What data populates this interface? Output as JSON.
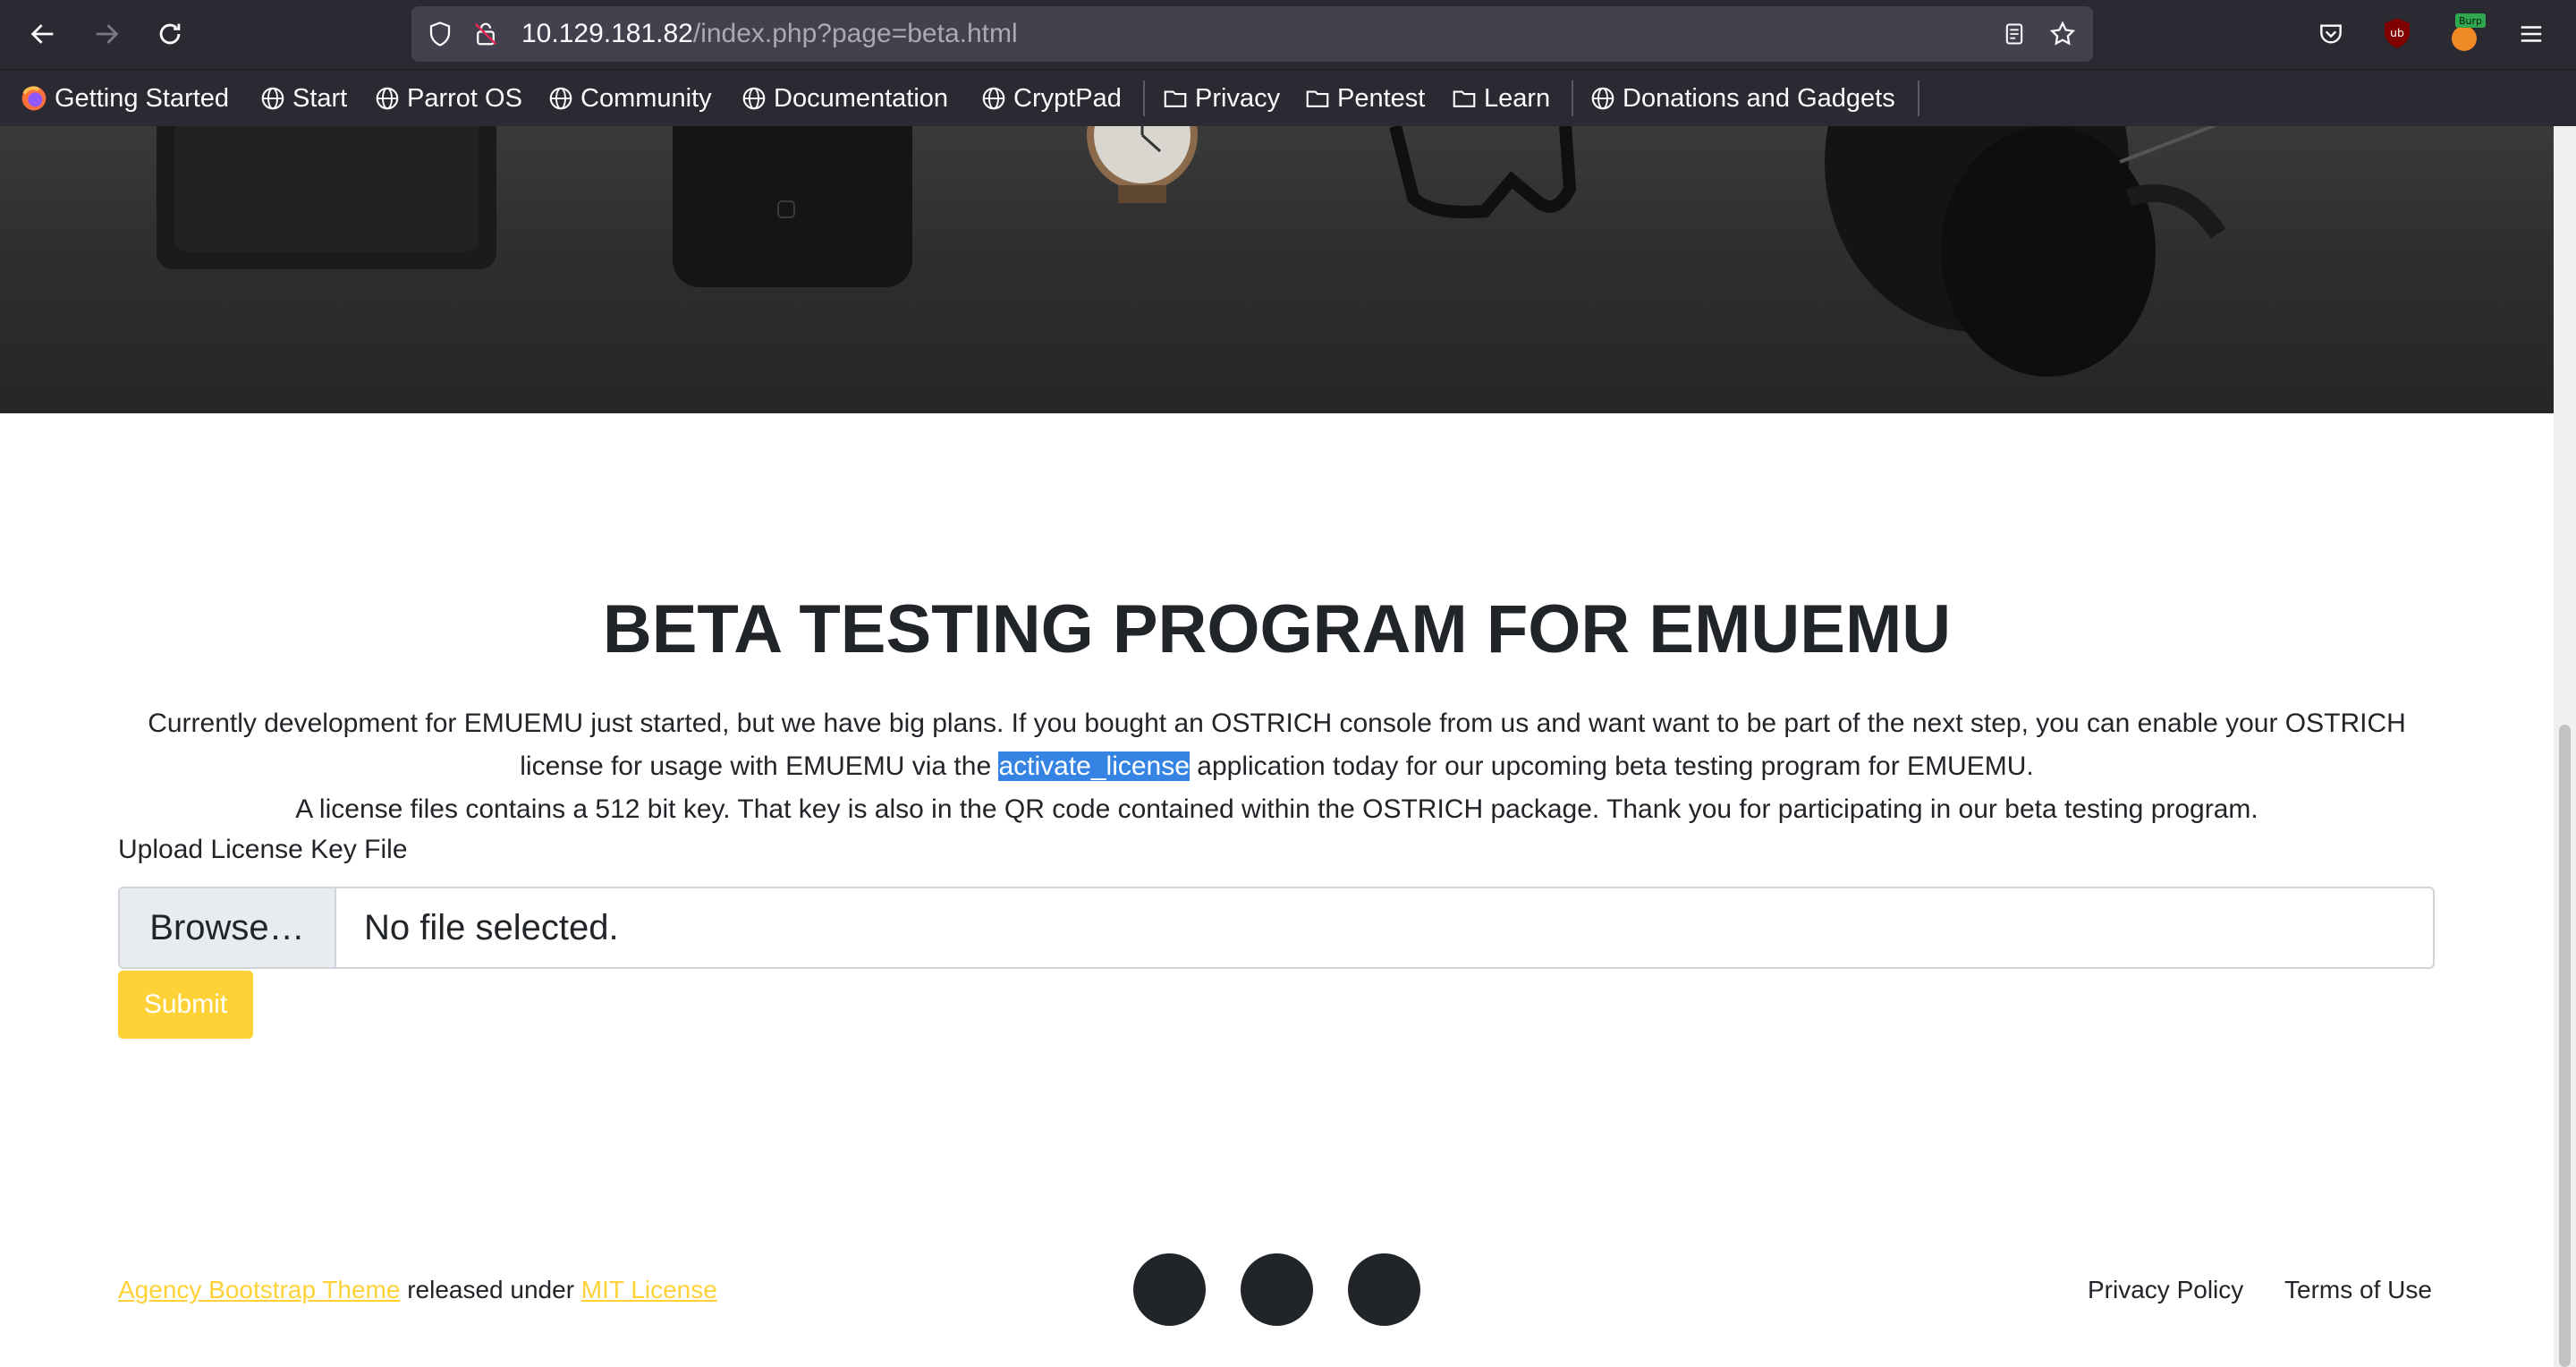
{
  "browser": {
    "url_host": "10.129.181.82",
    "url_path": "/index.php?page=beta.html",
    "burp_badge": "Burp",
    "ublock_badge": "ub"
  },
  "bookmarks": [
    {
      "label": "Getting Started",
      "icon": "firefox-icon"
    },
    {
      "label": "Start",
      "icon": "globe-icon"
    },
    {
      "label": "Parrot OS",
      "icon": "globe-icon"
    },
    {
      "label": "Community",
      "icon": "globe-icon"
    },
    {
      "label": "Documentation",
      "icon": "globe-icon"
    },
    {
      "label": "CryptPad",
      "icon": "globe-icon"
    },
    {
      "label": "Privacy",
      "icon": "folder-icon"
    },
    {
      "label": "Pentest",
      "icon": "folder-icon"
    },
    {
      "label": "Learn",
      "icon": "folder-icon"
    },
    {
      "label": "Donations and Gadgets",
      "icon": "globe-icon"
    }
  ],
  "page": {
    "title": "BETA TESTING PROGRAM FOR EMUEMU",
    "intro_part1": "Currently development for EMUEMU just started, but we have big plans. If you bought an OSTRICH console from us and want want to be part of the next step, you can enable your OSTRICH license for usage with EMUEMU via the ",
    "intro_highlight": "activate_license",
    "intro_part2": " application today for our upcoming beta testing program for EMUEMU.",
    "intro_line2": "A license files contains a 512 bit key. That key is also in the QR code contained within the OSTRICH package. Thank you for participating in our beta testing program.",
    "upload_label": "Upload License Key File",
    "browse_label": "Browse…",
    "file_status": "No file selected.",
    "submit_label": "Submit"
  },
  "footer": {
    "theme_link": "Agency Bootstrap Theme",
    "released_text": " released under ",
    "license_link": "MIT License",
    "privacy_link": "Privacy Policy",
    "terms_link": "Terms of Use"
  },
  "colors": {
    "accent": "#fed136",
    "chrome": "#2b2a33",
    "selection": "#3584e4"
  }
}
